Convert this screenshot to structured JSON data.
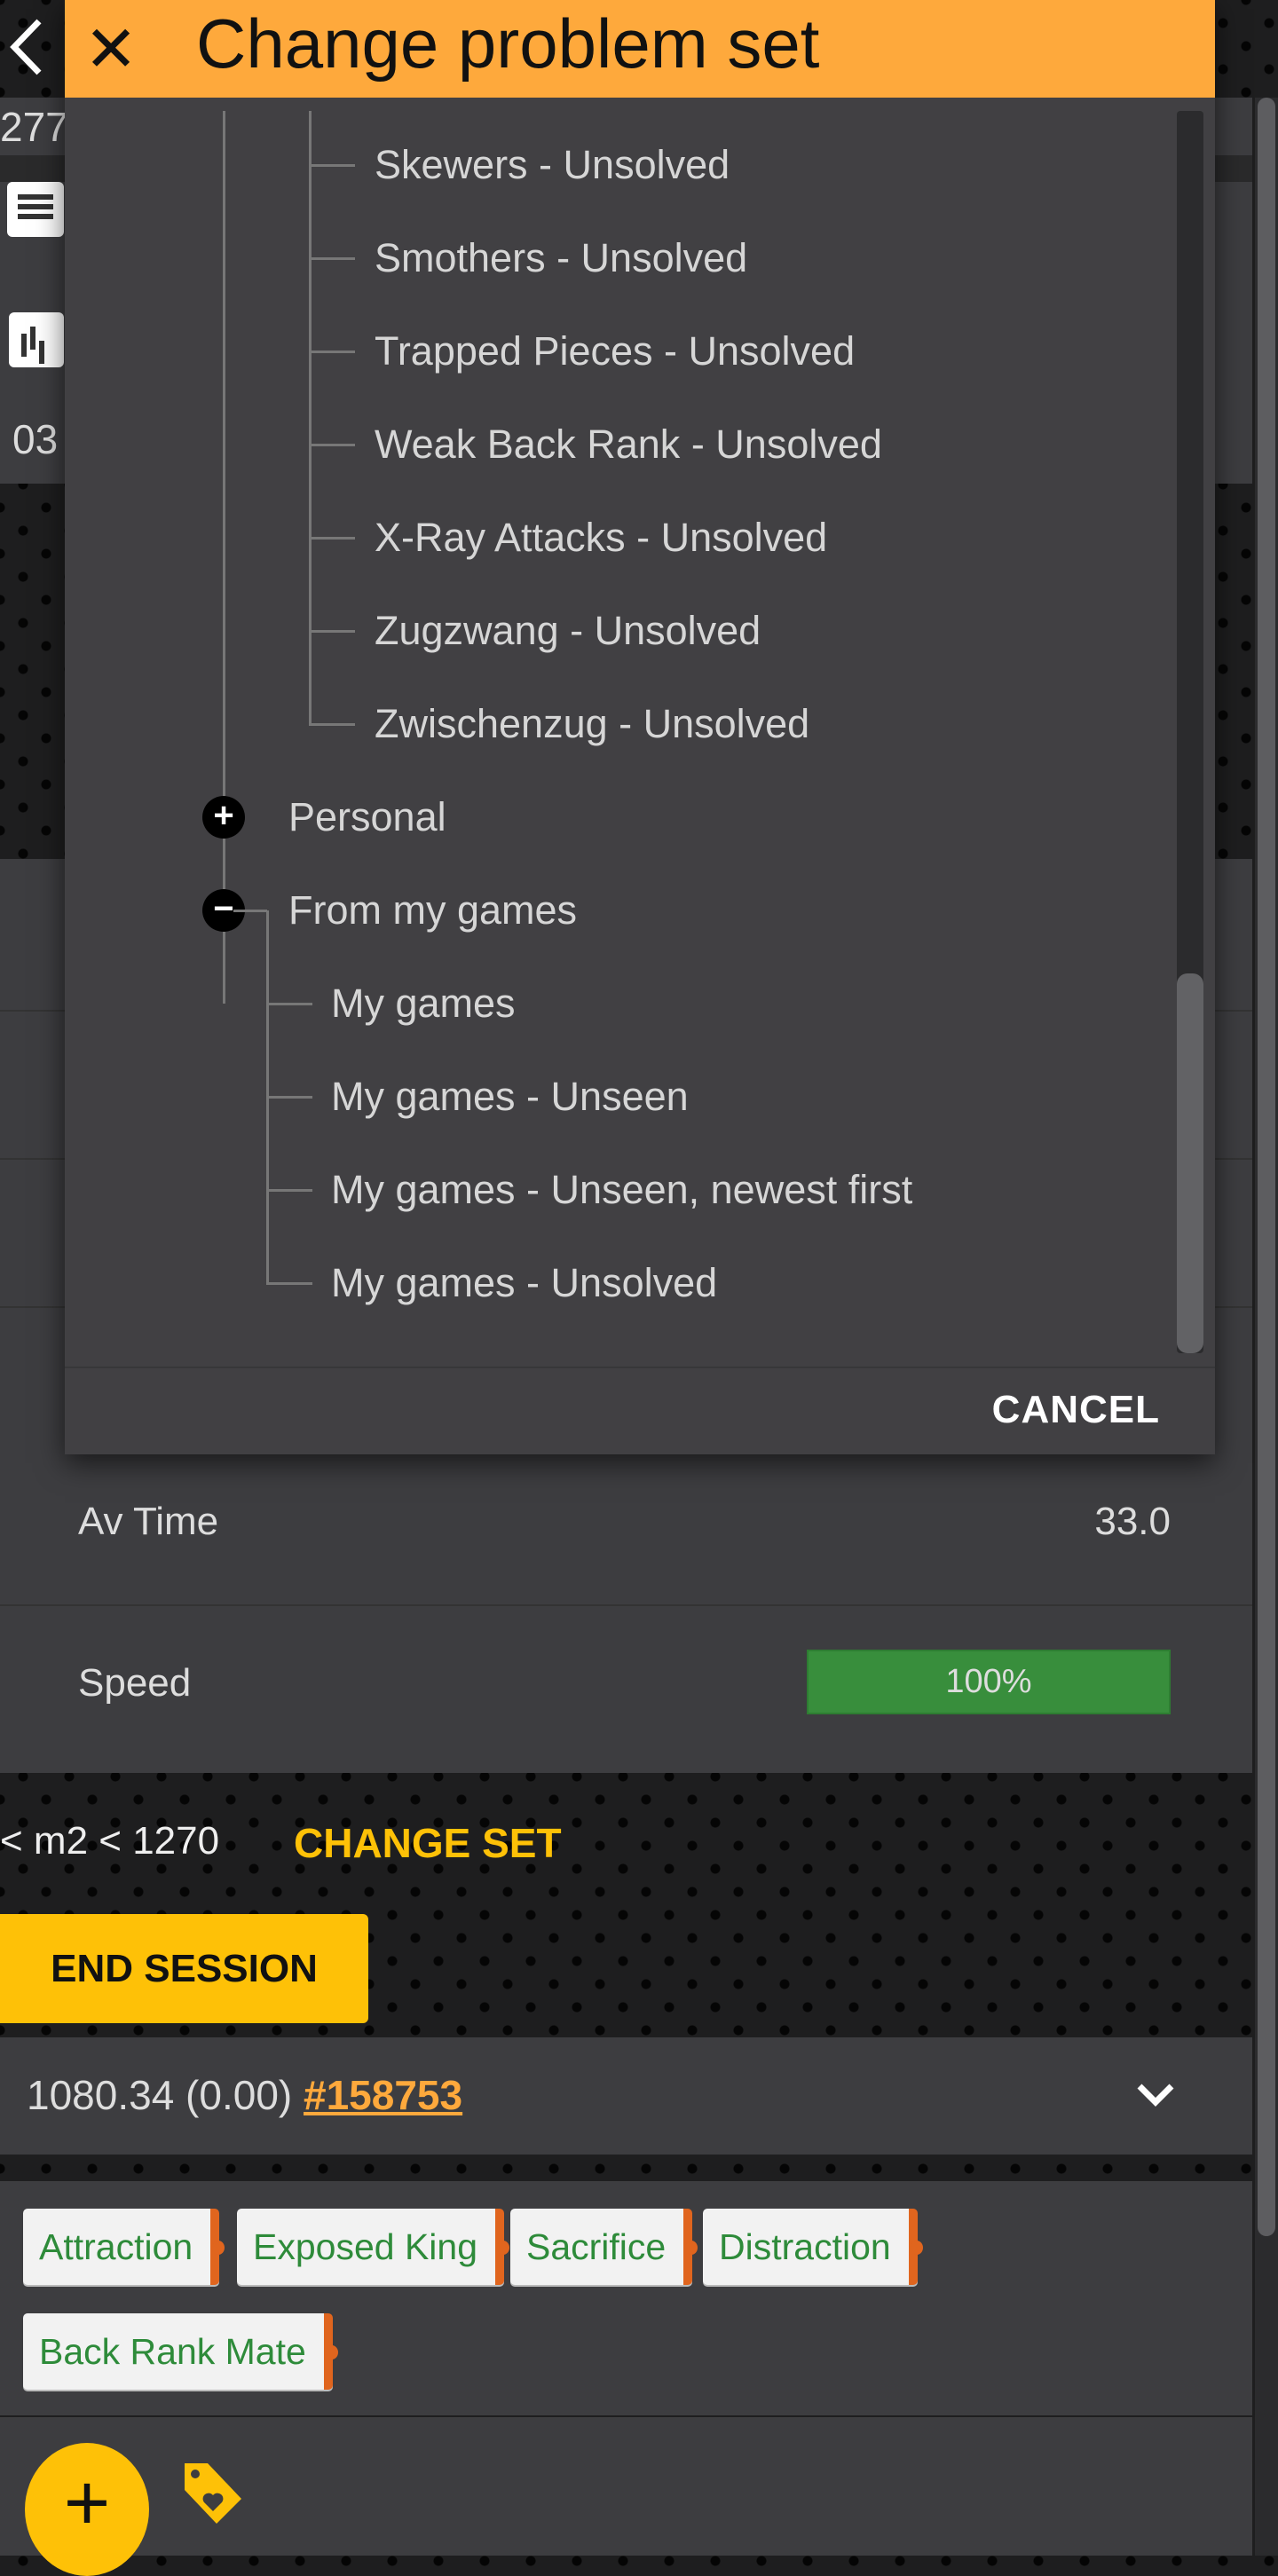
{
  "dialog": {
    "title": "Change problem set",
    "close_icon": "close-icon",
    "cancel_label": "CANCEL",
    "tree": {
      "nested_items": [
        "Skewers - Unsolved",
        "Smothers - Unsolved",
        "Trapped Pieces - Unsolved",
        "Weak Back Rank - Unsolved",
        "X-Ray Attacks - Unsolved",
        "Zugzwang - Unsolved",
        "Zwischenzug - Unsolved"
      ],
      "personal": {
        "label": "Personal",
        "state": "collapsed"
      },
      "from_my_games": {
        "label": "From my games",
        "state": "expanded",
        "children": [
          "My games",
          "My games - Unseen",
          "My games - Unseen, newest first",
          "My games - Unsolved"
        ]
      }
    }
  },
  "background": {
    "left_partial": {
      "rating": "277",
      "time": "03"
    },
    "stats": [
      {
        "label": "Av Time",
        "value": "33.0"
      },
      {
        "label": "Speed",
        "value": "100%",
        "fraction": 1.0,
        "color": "#388e3c"
      }
    ],
    "set_label": "< m2 < 1270",
    "change_set_label": "CHANGE SET",
    "end_session_label": "END SESSION",
    "problem": {
      "rating": "1080.34 (0.00)",
      "id": "#158753"
    },
    "tags": [
      "Attraction",
      "Exposed King",
      "Sacrifice",
      "Distraction",
      "Back Rank Mate"
    ]
  },
  "colors": {
    "accent": "#fec107",
    "header": "#fea93c",
    "tag_text": "#2e8b3a",
    "tag_edge": "#e0651e"
  }
}
